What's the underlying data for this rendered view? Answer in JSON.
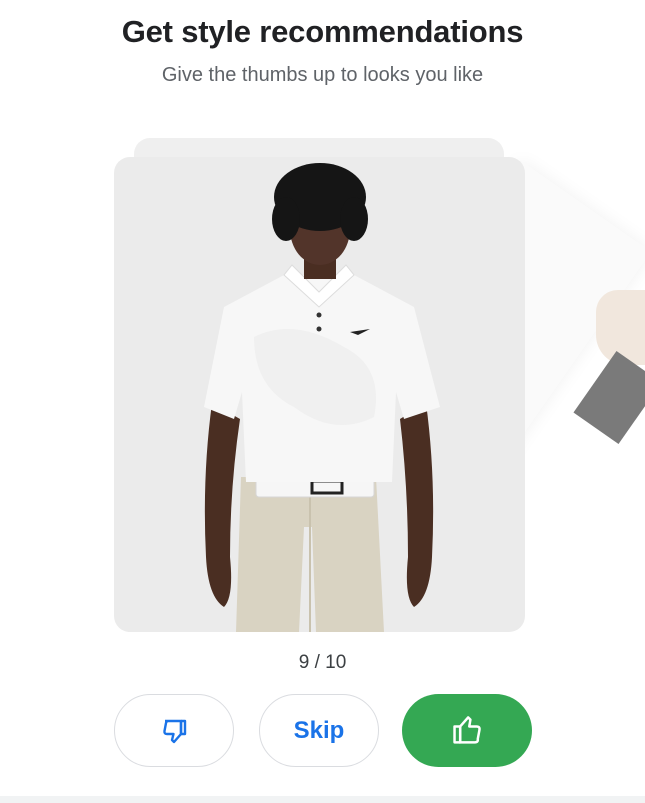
{
  "header": {
    "title": "Get style recommendations",
    "subtitle": "Give the thumbs up to looks you like"
  },
  "card": {
    "image_subject": "model-white-polo-khaki-pants",
    "background": "#ebebeb"
  },
  "progress": {
    "label": "9 / 10",
    "current": 9,
    "total": 10
  },
  "actions": {
    "dislike_icon": "thumbs-down-icon",
    "skip_label": "Skip",
    "like_icon": "thumbs-up-icon"
  },
  "colors": {
    "accent_blue": "#1a73e8",
    "like_green": "#34a853",
    "title_text": "#202124",
    "subtitle_text": "#5f6368"
  }
}
